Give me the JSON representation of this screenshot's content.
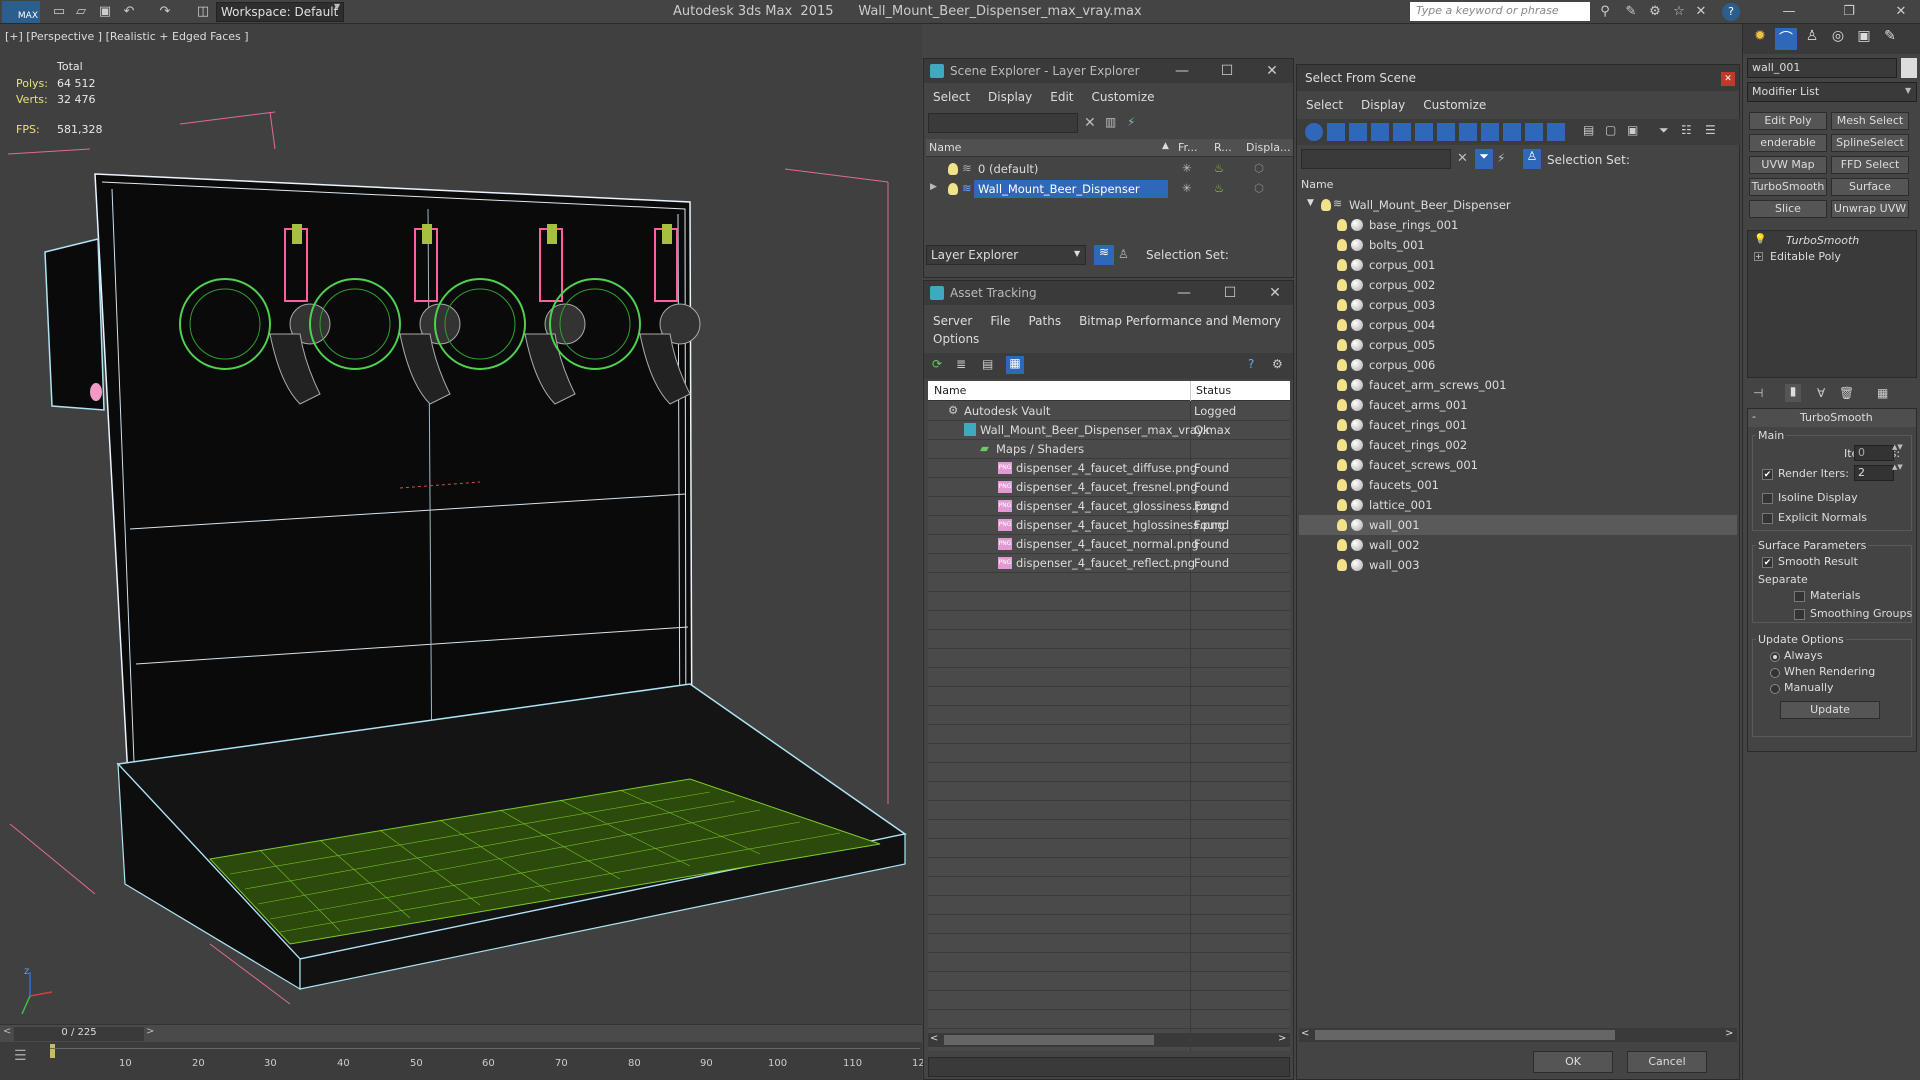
{
  "titlebar": {
    "logo": "MAX",
    "workspace": "Workspace: Default",
    "app_title": "Autodesk 3ds Max  2015      Wall_Mount_Beer_Dispenser_max_vray.max",
    "search_placeholder": "Type a keyword or phrase"
  },
  "viewport": {
    "label": "[+] [Perspective ] [Realistic + Edged Faces ]",
    "stats": {
      "total_label": "Total",
      "polys_label": "Polys:",
      "polys_value": "64 512",
      "verts_label": "Verts:",
      "verts_value": "32 476",
      "fps_label": "FPS:",
      "fps_value": "581,328"
    },
    "axis_label": "z"
  },
  "timeline": {
    "frame": "0 / 225",
    "ticks": [
      "10",
      "20",
      "30",
      "40",
      "50",
      "60",
      "70",
      "80",
      "90",
      "100",
      "110",
      "12"
    ]
  },
  "scene_explorer": {
    "title": "Scene Explorer - Layer Explorer",
    "menu": [
      "Select",
      "Display",
      "Edit",
      "Customize"
    ],
    "columns": [
      "Name",
      "Fr...",
      "R...",
      "Displa..."
    ],
    "layers": [
      {
        "name": "0 (default)"
      },
      {
        "name": "Wall_Mount_Beer_Dispenser"
      }
    ],
    "footer_dropdown": "Layer Explorer",
    "footer_selection": "Selection Set:"
  },
  "asset_tracking": {
    "title": "Asset Tracking",
    "menu": [
      "Server",
      "File",
      "Paths",
      "Bitmap Performance and Memory",
      "Options"
    ],
    "columns": [
      "Name",
      "Status"
    ],
    "rows": [
      {
        "name": "Autodesk Vault",
        "status": "Logged"
      },
      {
        "name": "Wall_Mount_Beer_Dispenser_max_vray.max",
        "status": "Ok"
      },
      {
        "name": "Maps / Shaders",
        "status": ""
      },
      {
        "name": "dispenser_4_faucet_diffuse.png",
        "status": "Found"
      },
      {
        "name": "dispenser_4_faucet_fresnel.png",
        "status": "Found"
      },
      {
        "name": "dispenser_4_faucet_glossiness.png",
        "status": "Found"
      },
      {
        "name": "dispenser_4_faucet_hglossiness.png",
        "status": "Found"
      },
      {
        "name": "dispenser_4_faucet_normal.png",
        "status": "Found"
      },
      {
        "name": "dispenser_4_faucet_reflect.png",
        "status": "Found"
      }
    ],
    "png_badge": "PNG"
  },
  "select_from_scene": {
    "title": "Select From Scene",
    "menu": [
      "Select",
      "Display",
      "Customize"
    ],
    "selection_set": "Selection Set:",
    "column": "Name",
    "root": "Wall_Mount_Beer_Dispenser",
    "items": [
      "base_rings_001",
      "bolts_001",
      "corpus_001",
      "corpus_002",
      "corpus_003",
      "corpus_004",
      "corpus_005",
      "corpus_006",
      "faucet_arm_screws_001",
      "faucet_arms_001",
      "faucet_rings_001",
      "faucet_rings_002",
      "faucet_screws_001",
      "faucets_001",
      "lattice_001",
      "wall_001",
      "wall_002",
      "wall_003"
    ],
    "ok": "OK",
    "cancel": "Cancel"
  },
  "command_panel": {
    "object_name": "wall_001",
    "modifier_list": "Modifier List",
    "buttons": [
      "Edit Poly",
      "Mesh Select",
      "enderable Splir",
      "SplineSelect",
      "UVW Map",
      "FFD Select",
      "TurboSmooth",
      "Surface Select",
      "Slice",
      "Unwrap UVW"
    ],
    "stack": [
      "TurboSmooth",
      "Editable Poly"
    ],
    "rollout_title": "TurboSmooth",
    "main_group": "Main",
    "iterations_label": "Iterations:",
    "iterations_value": "0",
    "render_iters_label": "Render Iters:",
    "render_iters_value": "2",
    "isoline": "Isoline Display",
    "explicit": "Explicit Normals",
    "surface_group": "Surface Parameters",
    "smooth_result": "Smooth Result",
    "separate": "Separate",
    "materials": "Materials",
    "smoothing_groups": "Smoothing Groups",
    "update_group": "Update Options",
    "always": "Always",
    "when_rendering": "When Rendering",
    "manually": "Manually",
    "update_btn": "Update"
  }
}
